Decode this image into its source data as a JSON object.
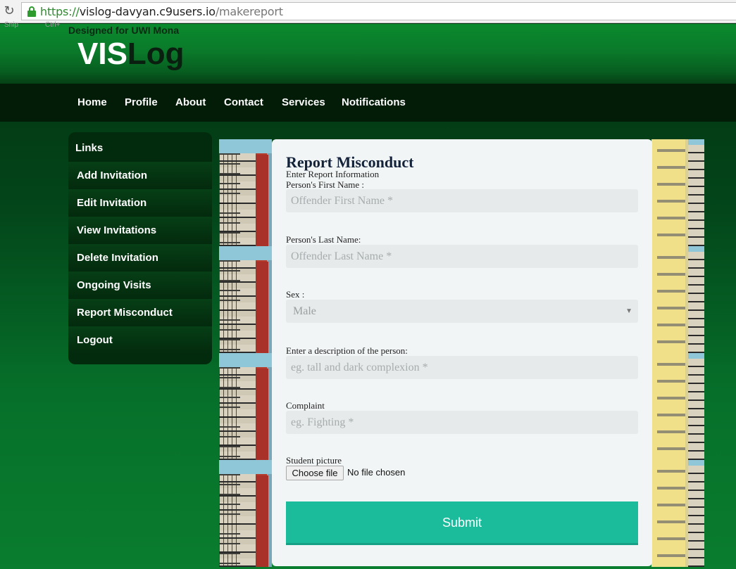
{
  "browser": {
    "url_scheme": "https://",
    "url_host": "vislog-davyan.c9users.io",
    "url_path": "/makereport",
    "ghost_snip": "Snip",
    "ghost_ctrl": "Ctrl+"
  },
  "header": {
    "tagline": "Designed for UWI Mona",
    "logo_vis": "VIS",
    "logo_log": "Log"
  },
  "nav": {
    "items": [
      "Home",
      "Profile",
      "About",
      "Contact",
      "Services",
      "Notifications"
    ]
  },
  "sidebar": {
    "heading": "Links",
    "items": [
      "Add Invitation",
      "Edit Invitation",
      "View Invitations",
      "Delete Invitation",
      "Ongoing Visits",
      "Report Misconduct",
      "Logout"
    ]
  },
  "form": {
    "title": "Report Misconduct",
    "subtitle": "Enter Report Information",
    "first_name_label": "Person's First Name :",
    "first_name_placeholder": "Offender First Name *",
    "last_name_label": "Person's Last Name:",
    "last_name_placeholder": "Offender Last Name *",
    "sex_label": "Sex :",
    "sex_value": "Male",
    "description_label": "Enter a description of the person:",
    "description_placeholder": "eg. tall and dark complexion *",
    "complaint_label": "Complaint",
    "complaint_placeholder": "eg. Fighting *",
    "picture_label": "Student picture",
    "choose_file": "Choose file",
    "file_status": "No file chosen",
    "submit": "Submit"
  },
  "colors": {
    "accent": "#1bbc9b",
    "nav_bg": "#021c08",
    "header_green": "#0a7a2a"
  },
  "icons": {
    "reload": "reload-icon",
    "lock": "lock-icon",
    "dropdown": "chevron-down-icon"
  }
}
